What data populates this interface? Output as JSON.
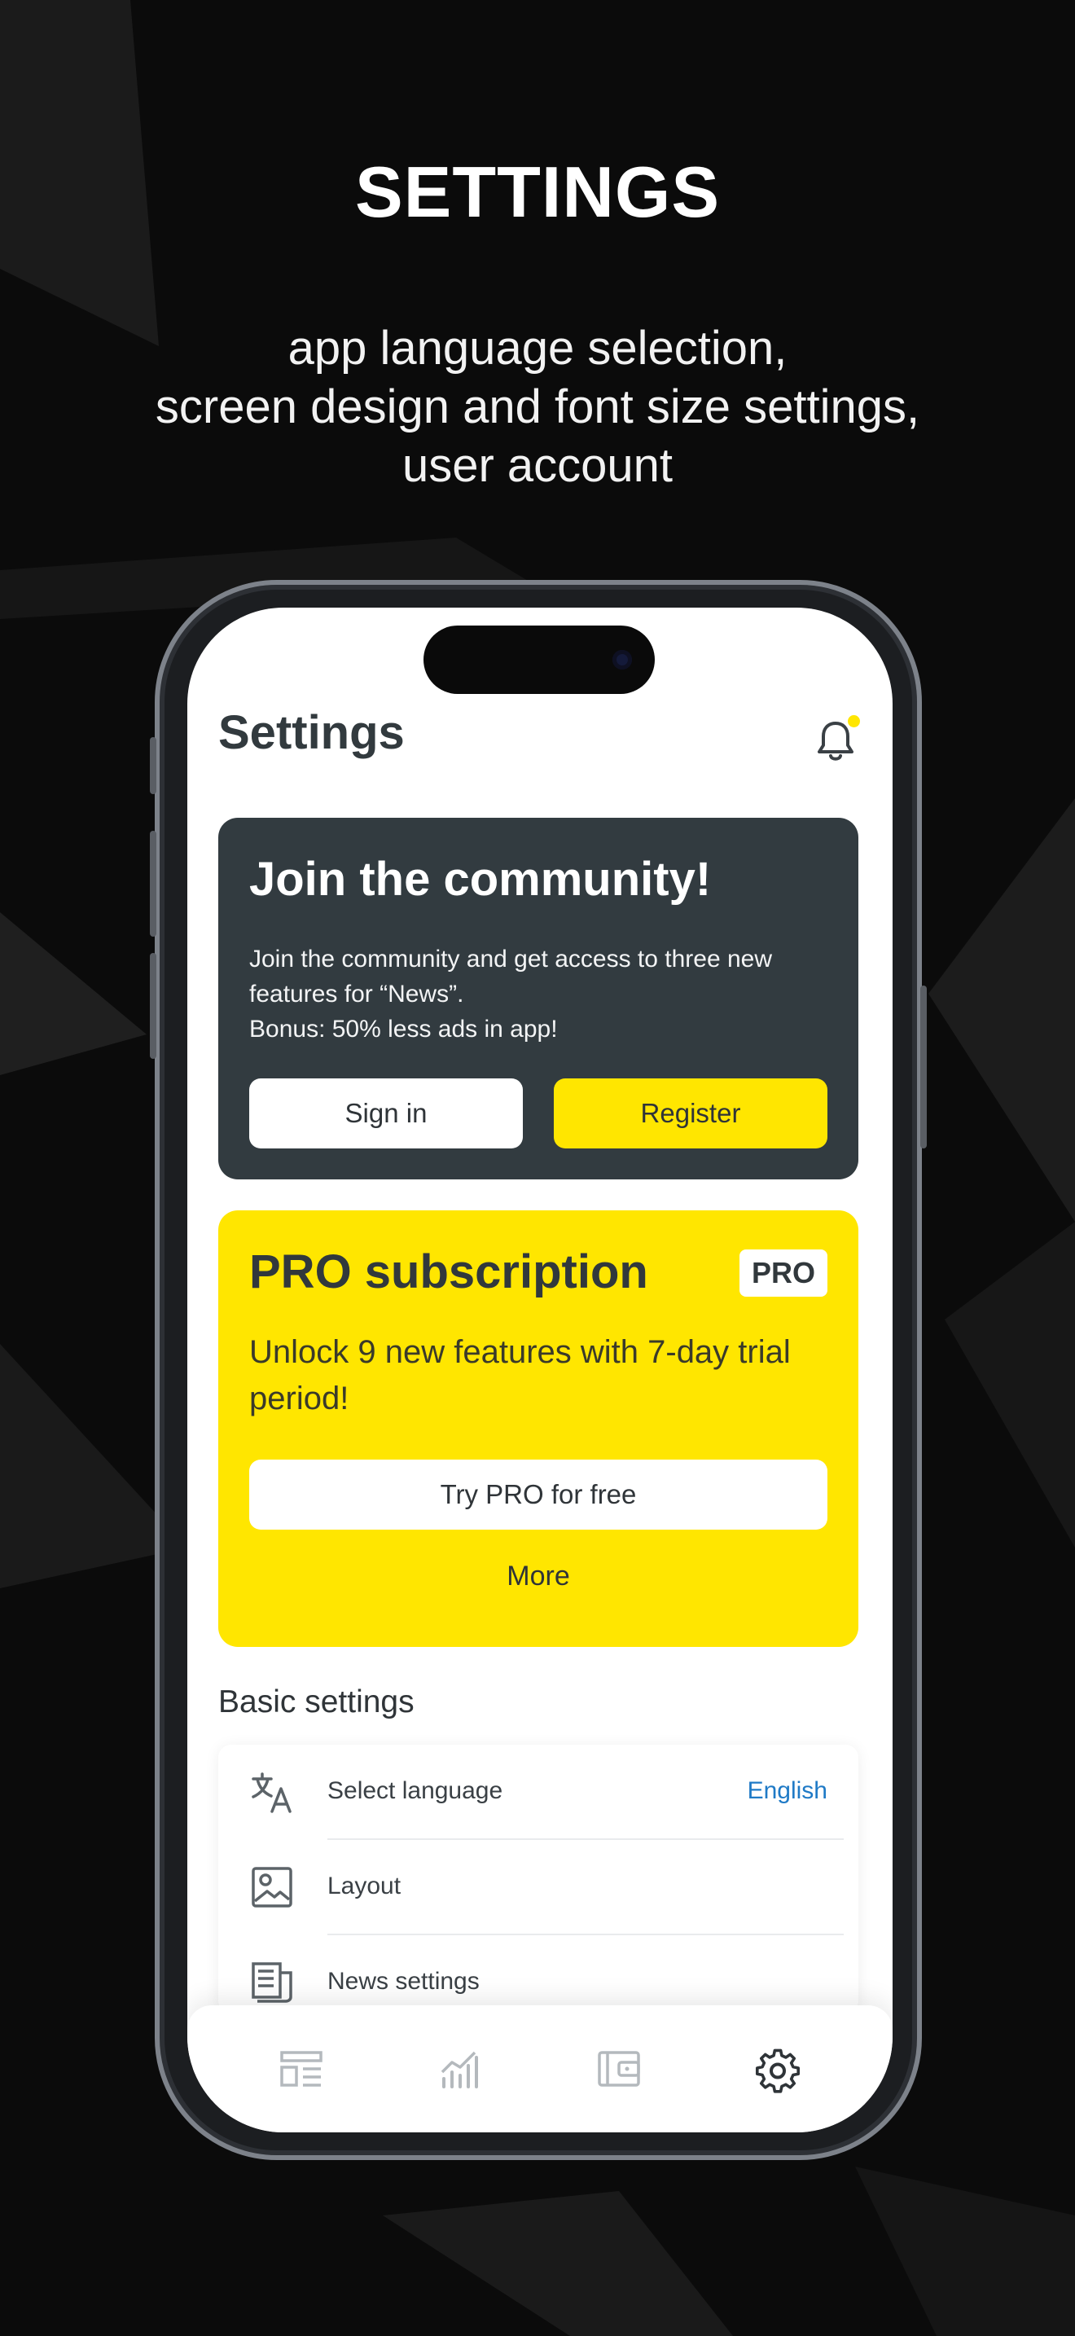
{
  "promo": {
    "title": "SETTINGS",
    "subtitle_lines": [
      "app language selection,",
      "screen design and font size settings,",
      "user account"
    ]
  },
  "app": {
    "header_title": "Settings",
    "community": {
      "title": "Join the community!",
      "text_line1": "Join the community and get access to three new",
      "text_line2": "features for “News”.",
      "text_line3": "Bonus: 50% less ads in app!",
      "signin_label": "Sign in",
      "register_label": "Register"
    },
    "pro": {
      "title": "PRO subscription",
      "badge": "PRO",
      "text": "Unlock 9 new features with 7-day trial period!",
      "try_label": "Try PRO for free",
      "more_label": "More"
    },
    "basic_settings": {
      "title": "Basic settings",
      "rows": [
        {
          "label": "Select language",
          "value": "English",
          "icon": "translate-icon"
        },
        {
          "label": "Layout",
          "value": "",
          "icon": "image-icon"
        },
        {
          "label": "News settings",
          "value": "",
          "icon": "news-icon"
        }
      ]
    },
    "tabs": [
      {
        "name": "news-tab",
        "icon": "layout-icon",
        "active": false
      },
      {
        "name": "stats-tab",
        "icon": "chart-icon",
        "active": false
      },
      {
        "name": "wallet-tab",
        "icon": "wallet-icon",
        "active": false
      },
      {
        "name": "settings-tab",
        "icon": "gear-icon",
        "active": true
      }
    ]
  },
  "colors": {
    "accent_yellow": "#ffe600",
    "dark_card": "#323b40",
    "link_blue": "#1f7ac6",
    "background": "#0b0b0b"
  }
}
